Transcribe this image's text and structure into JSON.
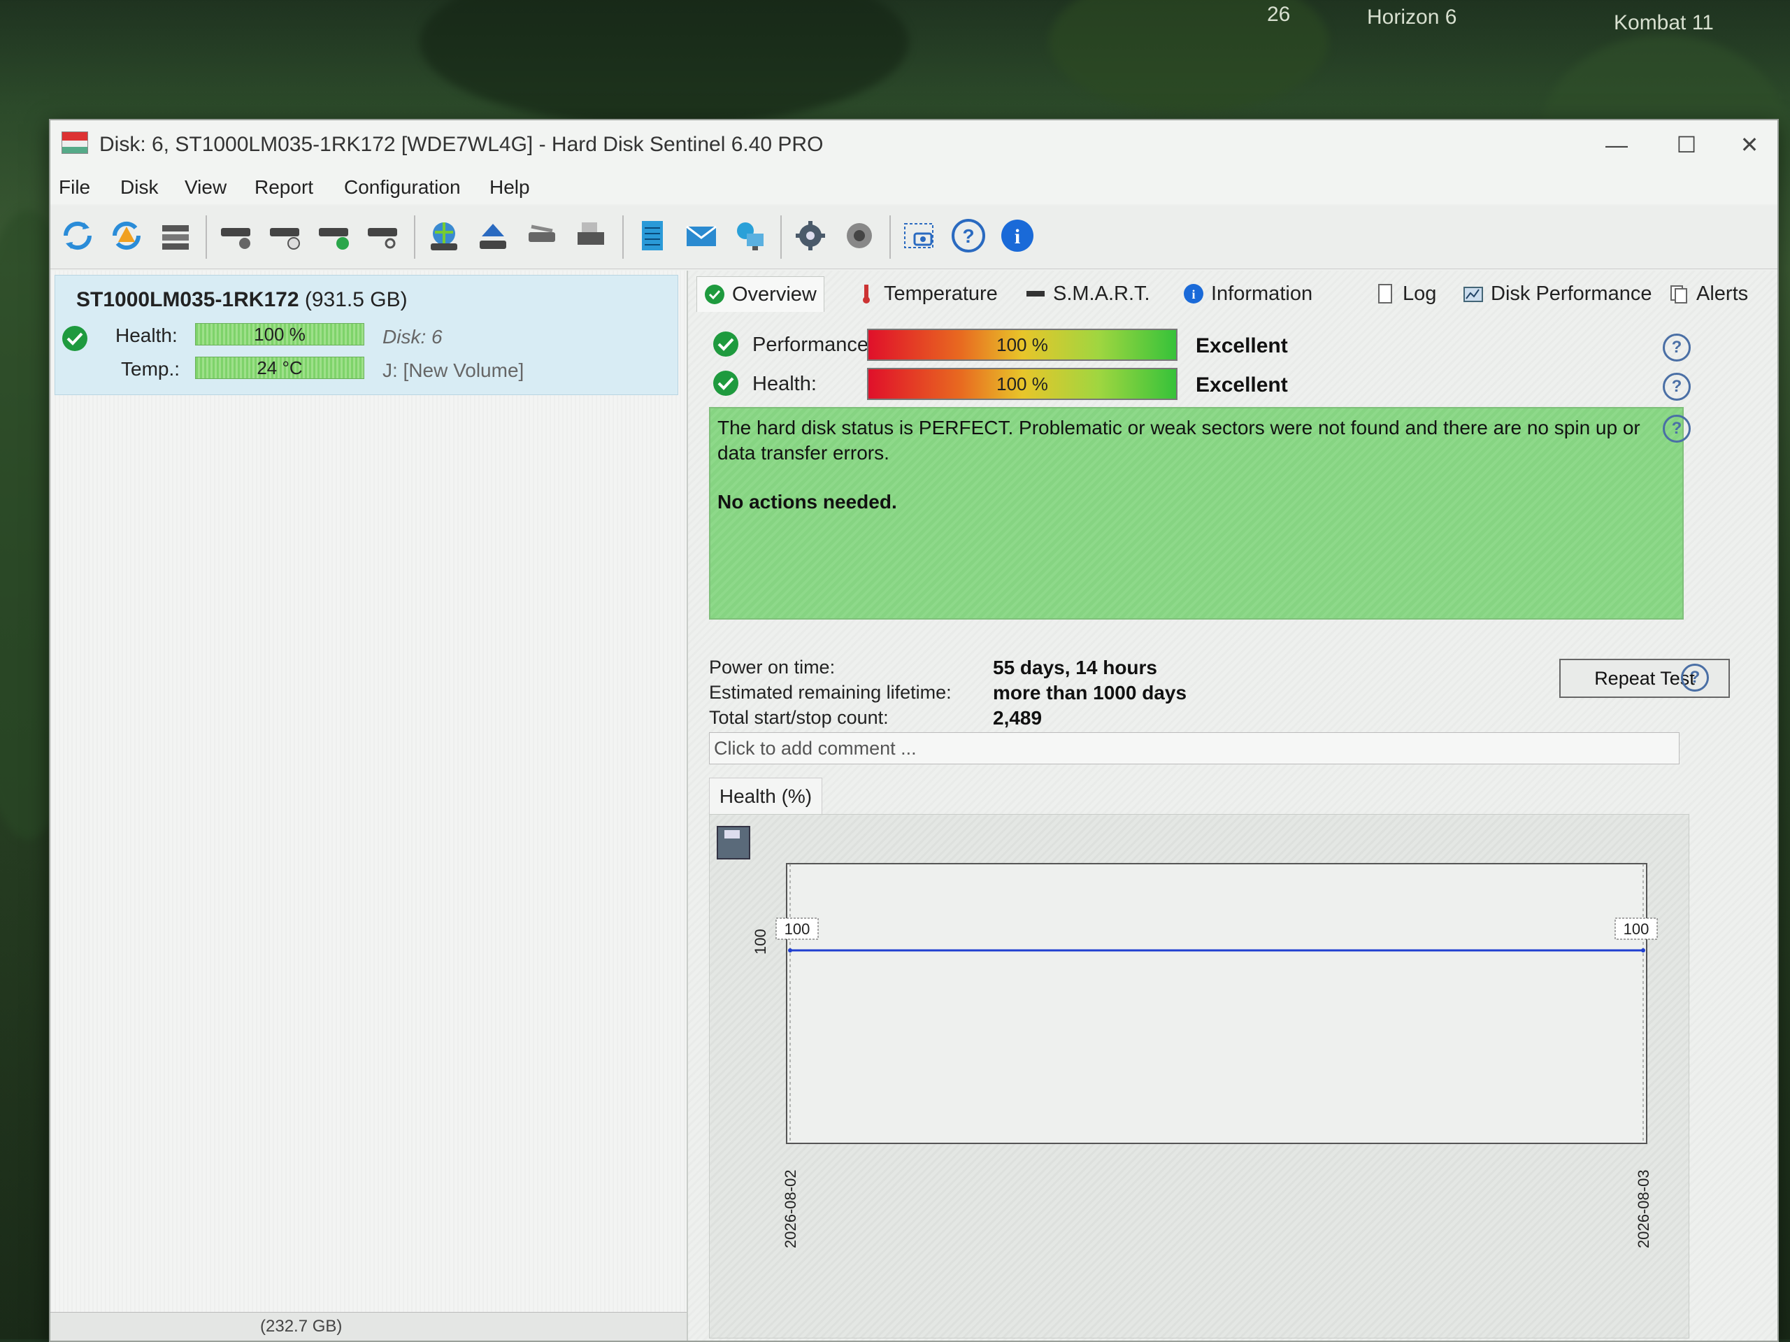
{
  "desktop": {
    "labels": [
      "26",
      "Horizon 6",
      "Kombat 11"
    ]
  },
  "window": {
    "title": "Disk: 6, ST1000LM035-1RK172 [WDE7WL4G]  -  Hard Disk Sentinel 6.40 PRO",
    "controls": {
      "minimize": "—",
      "maximize": "☐",
      "close": "✕"
    }
  },
  "menu": [
    "File",
    "Disk",
    "View",
    "Report",
    "Configuration",
    "Help"
  ],
  "toolbar": {
    "icons": [
      "refresh-icon",
      "refresh-warning-icon",
      "disk-list-icon",
      "disk-check-icon",
      "disk-clock-icon",
      "disk-ok-icon",
      "disk-search-icon",
      "globe-disk-icon",
      "eject-icon",
      "disk-tools-icon",
      "printer-icon",
      "notes-icon",
      "email-icon",
      "network-icon",
      "settings-icon",
      "sound-icon",
      "screenshot-icon",
      "help-icon",
      "info-icon"
    ]
  },
  "left": {
    "disk_model": "ST1000LM035-1RK172",
    "disk_capacity": "(931.5 GB)",
    "health_label": "Health:",
    "health_value": "100 %",
    "disk_number": "Disk: 6",
    "temp_label": "Temp.:",
    "temp_value": "24 °C",
    "volume": "J: [New Volume]",
    "footer": "(232.7 GB)"
  },
  "tabs": [
    {
      "label": "Overview",
      "icon": "check-icon"
    },
    {
      "label": "Temperature",
      "icon": "thermometer-icon"
    },
    {
      "label": "S.M.A.R.T.",
      "icon": "disk-icon"
    },
    {
      "label": "Information",
      "icon": "info-icon"
    },
    {
      "label": "Log",
      "icon": "document-icon"
    },
    {
      "label": "Disk Performance",
      "icon": "chart-icon"
    },
    {
      "label": "Alerts",
      "icon": "alerts-icon"
    }
  ],
  "overview": {
    "performance_label": "Performance:",
    "performance_value": "100 %",
    "performance_word": "Excellent",
    "health_label": "Health:",
    "health_value": "100 %",
    "health_word": "Excellent",
    "status_text": "The hard disk status is PERFECT. Problematic or weak sectors were not found and there are no spin up or data transfer errors.",
    "status_action": "No actions needed.",
    "power_on_label": "Power on time:",
    "power_on_value": "55 days, 14 hours",
    "lifetime_label": "Estimated remaining lifetime:",
    "lifetime_value": "more than 1000 days",
    "startstop_label": "Total start/stop count:",
    "startstop_value": "2,489",
    "repeat_button": "Repeat Test",
    "comment_placeholder": "Click to add comment ..."
  },
  "chart_data": {
    "type": "line",
    "tab_label": "Health (%)",
    "x": [
      "2026-08-02",
      "2026-08-03"
    ],
    "series": [
      {
        "values": [
          100,
          100
        ],
        "color": "#1f3fd0"
      }
    ],
    "data_labels": [
      "100",
      "100"
    ],
    "ylabel": "100",
    "ylim": [
      0,
      100
    ]
  }
}
